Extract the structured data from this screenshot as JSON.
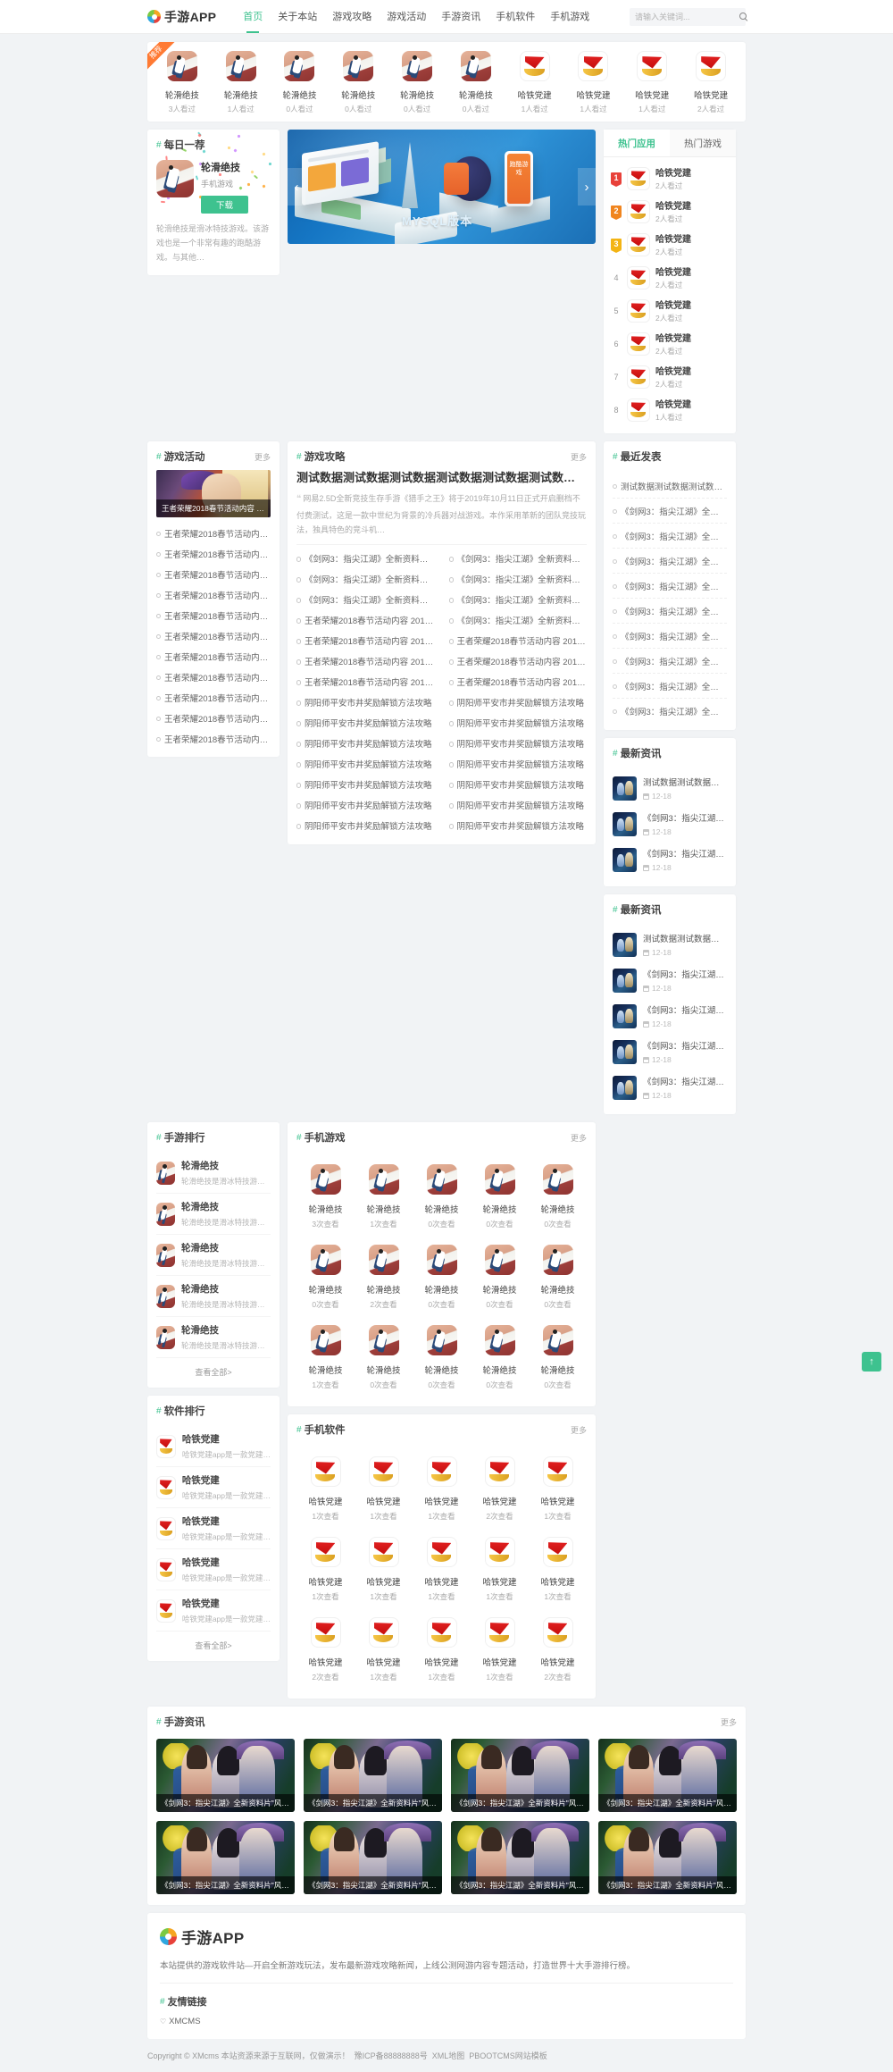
{
  "site": {
    "logo_text": "手游APP",
    "footer_desc": "本站提供的游戏软件站—开启全新游戏玩法，发布最新游戏攻略新闻，上线公测网游内容专题活动，打造世界十大手游排行榜。",
    "friend_links_title": "友情链接",
    "friend_link": "XMCMS",
    "copyright": "Copyright © XMcms 本站资源来源于互联网，仅做演示！",
    "icp": "豫ICP备88888888号",
    "xml": "XML地图",
    "template": "PBOOTCMS网站模板",
    "accent": "#3ec28f"
  },
  "nav": {
    "items": [
      {
        "label": "首页",
        "active": true
      },
      {
        "label": "关于本站",
        "active": false
      },
      {
        "label": "游戏攻略",
        "active": false
      },
      {
        "label": "游戏活动",
        "active": false
      },
      {
        "label": "手游资讯",
        "active": false
      },
      {
        "label": "手机软件",
        "active": false
      },
      {
        "label": "手机游戏",
        "active": false
      }
    ]
  },
  "search": {
    "placeholder": "请输入关键词...",
    "value": ""
  },
  "top_strip": {
    "ribbon": "推荐",
    "apps": [
      {
        "name": "轮滑绝技",
        "count": "3人看过",
        "icon": "skate"
      },
      {
        "name": "轮滑绝技",
        "count": "1人看过",
        "icon": "skate"
      },
      {
        "name": "轮滑绝技",
        "count": "0人看过",
        "icon": "skate"
      },
      {
        "name": "轮滑绝技",
        "count": "0人看过",
        "icon": "skate"
      },
      {
        "name": "轮滑绝技",
        "count": "0人看过",
        "icon": "skate"
      },
      {
        "name": "轮滑绝技",
        "count": "0人看过",
        "icon": "skate"
      },
      {
        "name": "哈铁党建",
        "count": "1人看过",
        "icon": "party"
      },
      {
        "name": "哈铁党建",
        "count": "1人看过",
        "icon": "party"
      },
      {
        "name": "哈铁党建",
        "count": "1人看过",
        "icon": "party"
      },
      {
        "name": "哈铁党建",
        "count": "2人看过",
        "icon": "party"
      }
    ]
  },
  "daily": {
    "title": "每日一荐",
    "app_name": "轮滑绝技",
    "category": "手机游戏",
    "download_label": "下载",
    "desc": "轮滑绝技是滑冰特技游戏。该游戏也是一个非常有趣的跑酷游戏。与其他…"
  },
  "banner": {
    "caption": "MYSQL版本",
    "phone_text": "跑酷游戏",
    "prev": "‹",
    "next": "›"
  },
  "hot": {
    "tabs": [
      {
        "label": "热门应用",
        "active": true
      },
      {
        "label": "热门游戏",
        "active": false
      }
    ],
    "items": [
      {
        "rank": "1",
        "name": "哈铁党建",
        "count": "2人看过"
      },
      {
        "rank": "2",
        "name": "哈铁党建",
        "count": "2人看过"
      },
      {
        "rank": "3",
        "name": "哈铁党建",
        "count": "2人看过"
      },
      {
        "rank": "4",
        "name": "哈铁党建",
        "count": "2人看过"
      },
      {
        "rank": "5",
        "name": "哈铁党建",
        "count": "2人看过"
      },
      {
        "rank": "6",
        "name": "哈铁党建",
        "count": "2人看过"
      },
      {
        "rank": "7",
        "name": "哈铁党建",
        "count": "2人看过"
      },
      {
        "rank": "8",
        "name": "哈铁党建",
        "count": "1人看过"
      }
    ]
  },
  "activity": {
    "title": "游戏活动",
    "more": "更多",
    "feature_title": "王者荣耀2018春节活动内容 2...",
    "items": [
      "王者荣耀2018春节活动内容 2018…",
      "王者荣耀2018春节活动内容 2018…",
      "王者荣耀2018春节活动内容 2018…",
      "王者荣耀2018春节活动内容 2018…",
      "王者荣耀2018春节活动内容 2018…",
      "王者荣耀2018春节活动内容 2018…",
      "王者荣耀2018春节活动内容 2018…",
      "王者荣耀2018春节活动内容 2018…",
      "王者荣耀2018春节活动内容 2018…",
      "王者荣耀2018春节活动内容 2018…",
      "王者荣耀2018春节活动内容 2018…"
    ]
  },
  "strategy": {
    "title": "游戏攻略",
    "more": "更多",
    "headline": "测试数据测试数据测试数据测试数据测试数据测试数据测试数据测试…",
    "desc": "网易2.5D全新竞技生存手游《猎手之王》将于2019年10月11日正式开启删档不付费测试，这是一款中世纪为背景的冷兵器对战游戏。本作采用革新的团队竞技玩法，独具特色的竞斗机…",
    "left_items": [
      "《剑网3：指尖江湖》全新资料片\"风起稻香…",
      "《剑网3：指尖江湖》全新资料片\"风起稻香…",
      "《剑网3：指尖江湖》全新资料片\"风起稻香…",
      "王者荣耀2018春节活动内容 2018年王者…",
      "王者荣耀2018春节活动内容 2018年王者…",
      "王者荣耀2018春节活动内容 2018年王者…",
      "王者荣耀2018春节活动内容 2018年王者…",
      "阴阳师平安市井奖励解锁方法攻略",
      "阴阳师平安市井奖励解锁方法攻略",
      "阴阳师平安市井奖励解锁方法攻略",
      "阴阳师平安市井奖励解锁方法攻略",
      "阴阳师平安市井奖励解锁方法攻略",
      "阴阳师平安市井奖励解锁方法攻略",
      "阴阳师平安市井奖励解锁方法攻略"
    ],
    "right_items": [
      "《剑网3：指尖江湖》全新资料片\"风起稻香…",
      "《剑网3：指尖江湖》全新资料片\"风起稻香…",
      "《剑网3：指尖江湖》全新资料片\"风起稻香…",
      "《剑网3：指尖江湖》全新资料片\"风起稻香…",
      "王者荣耀2018春节活动内容 2018年王者…",
      "王者荣耀2018春节活动内容 2018年王者…",
      "王者荣耀2018春节活动内容 2018年王者…",
      "阴阳师平安市井奖励解锁方法攻略",
      "阴阳师平安市井奖励解锁方法攻略",
      "阴阳师平安市井奖励解锁方法攻略",
      "阴阳师平安市井奖励解锁方法攻略",
      "阴阳师平安市井奖励解锁方法攻略",
      "阴阳师平安市井奖励解锁方法攻略",
      "阴阳师平安市井奖励解锁方法攻略"
    ]
  },
  "game_rank": {
    "title": "手游排行",
    "see_all": "查看全部>",
    "items": [
      {
        "name": "轮滑绝技",
        "desc": "轮滑绝技是滑冰特技游戏…"
      },
      {
        "name": "轮滑绝技",
        "desc": "轮滑绝技是滑冰特技游戏…"
      },
      {
        "name": "轮滑绝技",
        "desc": "轮滑绝技是滑冰特技游戏…"
      },
      {
        "name": "轮滑绝技",
        "desc": "轮滑绝技是滑冰特技游戏…"
      },
      {
        "name": "轮滑绝技",
        "desc": "轮滑绝技是滑冰特技游戏…"
      }
    ]
  },
  "software_rank": {
    "title": "软件排行",
    "see_all": "查看全部>",
    "items": [
      {
        "name": "哈铁党建",
        "desc": "哈铁党建app是一款党建…"
      },
      {
        "name": "哈铁党建",
        "desc": "哈铁党建app是一款党建…"
      },
      {
        "name": "哈铁党建",
        "desc": "哈铁党建app是一款党建…"
      },
      {
        "name": "哈铁党建",
        "desc": "哈铁党建app是一款党建…"
      },
      {
        "name": "哈铁党建",
        "desc": "哈铁党建app是一款党建…"
      }
    ]
  },
  "mobile_games": {
    "title": "手机游戏",
    "more": "更多",
    "items": [
      {
        "name": "轮滑绝技",
        "count": "3次查看"
      },
      {
        "name": "轮滑绝技",
        "count": "1次查看"
      },
      {
        "name": "轮滑绝技",
        "count": "0次查看"
      },
      {
        "name": "轮滑绝技",
        "count": "0次查看"
      },
      {
        "name": "轮滑绝技",
        "count": "0次查看"
      },
      {
        "name": "轮滑绝技",
        "count": "0次查看"
      },
      {
        "name": "轮滑绝技",
        "count": "2次查看"
      },
      {
        "name": "轮滑绝技",
        "count": "0次查看"
      },
      {
        "name": "轮滑绝技",
        "count": "0次查看"
      },
      {
        "name": "轮滑绝技",
        "count": "0次查看"
      },
      {
        "name": "轮滑绝技",
        "count": "1次查看"
      },
      {
        "name": "轮滑绝技",
        "count": "0次查看"
      },
      {
        "name": "轮滑绝技",
        "count": "0次查看"
      },
      {
        "name": "轮滑绝技",
        "count": "0次查看"
      },
      {
        "name": "轮滑绝技",
        "count": "0次查看"
      }
    ]
  },
  "mobile_software": {
    "title": "手机软件",
    "more": "更多",
    "items": [
      {
        "name": "哈铁党建",
        "count": "1次查看"
      },
      {
        "name": "哈铁党建",
        "count": "1次查看"
      },
      {
        "name": "哈铁党建",
        "count": "1次查看"
      },
      {
        "name": "哈铁党建",
        "count": "2次查看"
      },
      {
        "name": "哈铁党建",
        "count": "1次查看"
      },
      {
        "name": "哈铁党建",
        "count": "1次查看"
      },
      {
        "name": "哈铁党建",
        "count": "1次查看"
      },
      {
        "name": "哈铁党建",
        "count": "1次查看"
      },
      {
        "name": "哈铁党建",
        "count": "1次查看"
      },
      {
        "name": "哈铁党建",
        "count": "1次查看"
      },
      {
        "name": "哈铁党建",
        "count": "2次查看"
      },
      {
        "name": "哈铁党建",
        "count": "1次查看"
      },
      {
        "name": "哈铁党建",
        "count": "1次查看"
      },
      {
        "name": "哈铁党建",
        "count": "1次查看"
      },
      {
        "name": "哈铁党建",
        "count": "2次查看"
      }
    ]
  },
  "recent_posts": {
    "title": "最近发表",
    "items": [
      "测试数据测试数据测试数据测试…",
      "《剑网3：指尖江湖》全新资料…",
      "《剑网3：指尖江湖》全新资料…",
      "《剑网3：指尖江湖》全新资料…",
      "《剑网3：指尖江湖》全新资料…",
      "《剑网3：指尖江湖》全新资料…",
      "《剑网3：指尖江湖》全新资料…",
      "《剑网3：指尖江湖》全新资料…",
      "《剑网3：指尖江湖》全新资料…",
      "《剑网3：指尖江湖》全新资料…"
    ]
  },
  "latest_news_1": {
    "title": "最新资讯",
    "items": [
      {
        "title": "测试数据测试数据测试数…",
        "date": "12-18"
      },
      {
        "title": "《剑网3：指尖江湖》全新…",
        "date": "12-18"
      },
      {
        "title": "《剑网3：指尖江湖》全新…",
        "date": "12-18"
      }
    ]
  },
  "latest_news_2": {
    "title": "最新资讯",
    "items": [
      {
        "title": "测试数据测试数据测试数…",
        "date": "12-18"
      },
      {
        "title": "《剑网3：指尖江湖》全新…",
        "date": "12-18"
      },
      {
        "title": "《剑网3：指尖江湖》全新…",
        "date": "12-18"
      },
      {
        "title": "《剑网3：指尖江湖》全新…",
        "date": "12-18"
      },
      {
        "title": "《剑网3：指尖江湖》全新…",
        "date": "12-18"
      }
    ]
  },
  "game_news": {
    "title": "手游资讯",
    "more": "更多",
    "items": [
      {
        "title": "《剑网3：指尖江湖》全新资料片\"风起…"
      },
      {
        "title": "《剑网3：指尖江湖》全新资料片\"风起…"
      },
      {
        "title": "《剑网3：指尖江湖》全新资料片\"风起…"
      },
      {
        "title": "《剑网3：指尖江湖》全新资料片\"风起…"
      },
      {
        "title": "《剑网3：指尖江湖》全新资料片\"风起…"
      },
      {
        "title": "《剑网3：指尖江湖》全新资料片\"风起…"
      },
      {
        "title": "《剑网3：指尖江湖》全新资料片\"风起…"
      },
      {
        "title": "《剑网3：指尖江湖》全新资料片\"风起…"
      }
    ]
  },
  "to_top": {
    "label": "↑"
  }
}
